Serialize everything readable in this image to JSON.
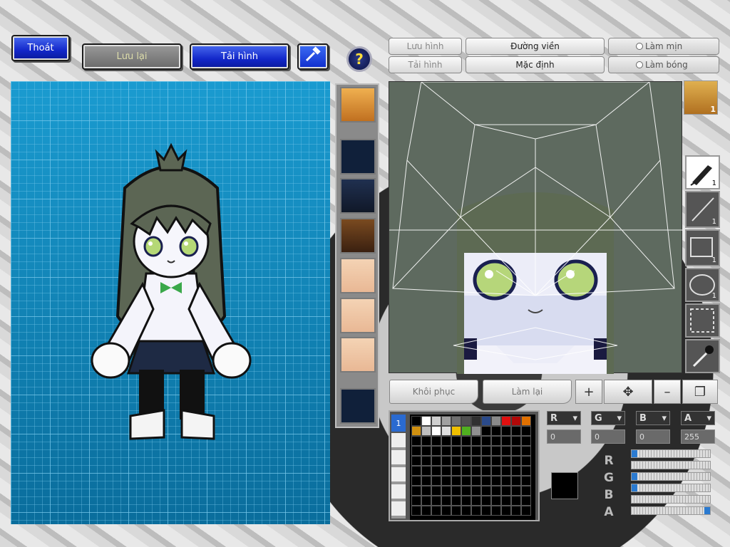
{
  "toolbar": {
    "exit_label": "Thoát",
    "save_label": "Lưu lại",
    "load_label": "Tải hình",
    "help_label": "?"
  },
  "editor_tabs": {
    "save_image": "Lưu hình",
    "load_image": "Tải hình",
    "outline": "Đường viền",
    "default": "Mặc định",
    "smooth": "Làm mịn",
    "shade": "Làm bóng"
  },
  "tools": [
    {
      "name": "pen-tool",
      "count": "1"
    },
    {
      "name": "line-tool",
      "count": "1"
    },
    {
      "name": "rectangle-tool",
      "count": "1"
    },
    {
      "name": "ellipse-tool",
      "count": "1"
    },
    {
      "name": "selection-tool",
      "count": ""
    },
    {
      "name": "eyedropper-tool",
      "count": ""
    }
  ],
  "face_preview_count": "1",
  "edit_buttons": {
    "restore": "Khôi phục",
    "redo": "Làm lại"
  },
  "palette": {
    "tab_label": "1",
    "colors": [
      "#000000",
      "#ffffff",
      "#d0d0d0",
      "#a0a0a0",
      "#707070",
      "#505050",
      "#303030",
      "#2a4a8a",
      "#8a8a8a",
      "#e01010",
      "#b00808",
      "#e07000",
      "#d09010",
      "#c0c0c0",
      "#ffffff",
      "#e0e0e0",
      "#f0c000",
      "#50b020",
      "#909090"
    ]
  },
  "color_channels": [
    {
      "label": "R",
      "value": "0"
    },
    {
      "label": "G",
      "value": "0"
    },
    {
      "label": "B",
      "value": "0"
    },
    {
      "label": "A",
      "value": "255"
    }
  ],
  "slider_labels": [
    "R",
    "G",
    "B",
    "A"
  ],
  "current_color": "#000000"
}
